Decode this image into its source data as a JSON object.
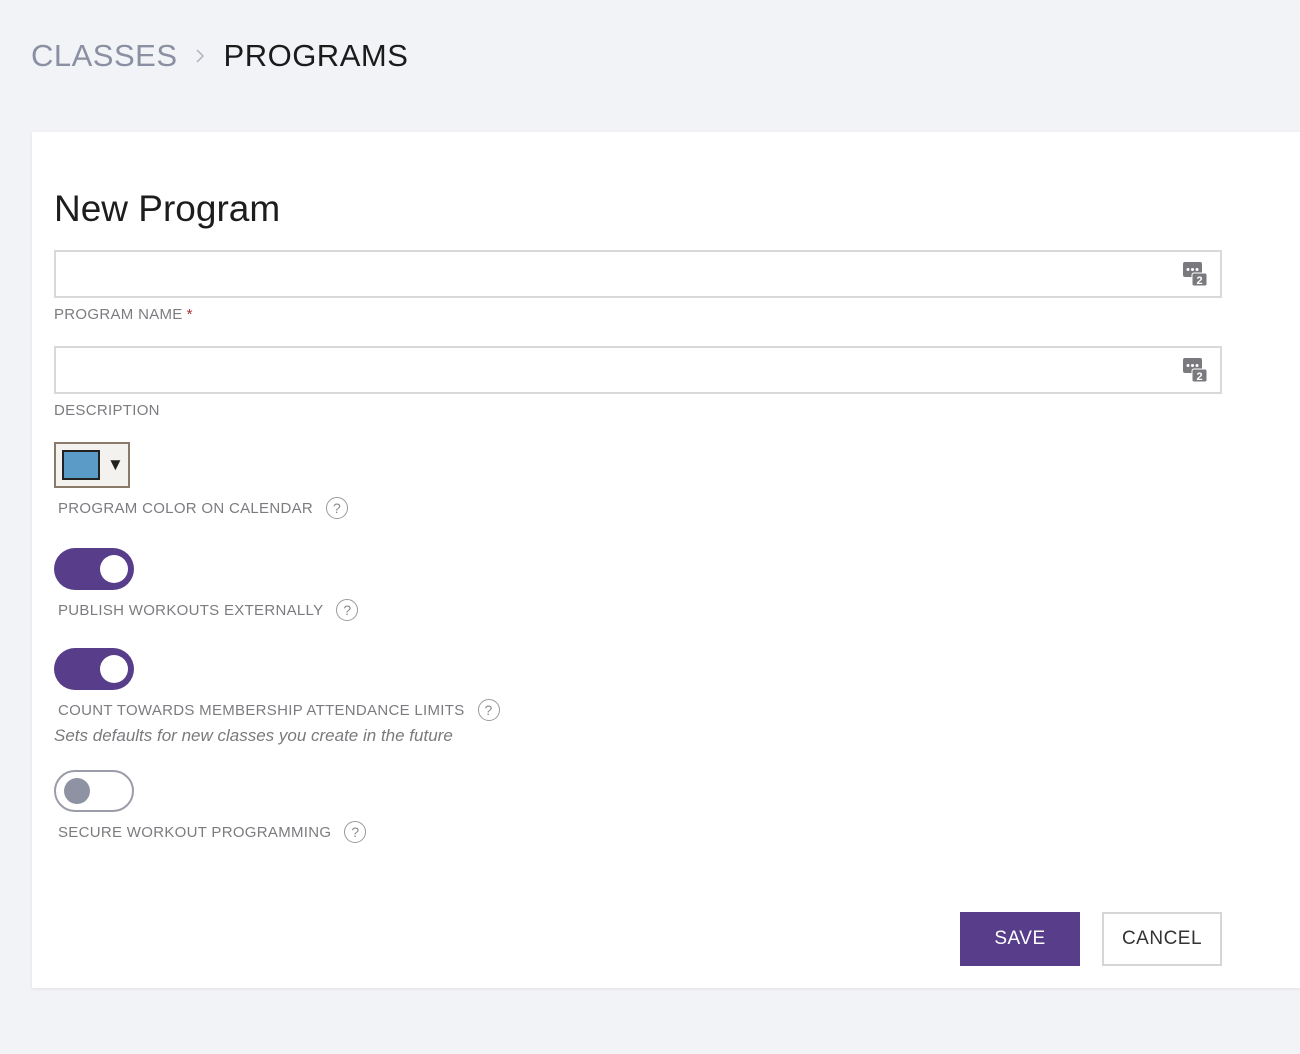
{
  "breadcrumb": {
    "parent": "CLASSES",
    "current": "PROGRAMS"
  },
  "form": {
    "title": "New Program",
    "program_name": {
      "value": "",
      "placeholder": "",
      "label": "PROGRAM NAME",
      "required_marker": "*",
      "icon": "translate-icon"
    },
    "description": {
      "value": "",
      "placeholder": "",
      "label": "DESCRIPTION",
      "icon": "translate-icon"
    },
    "program_color": {
      "label": "PROGRAM COLOR ON CALENDAR",
      "value": "#5b9bc7",
      "caret": "▼",
      "help": "?"
    },
    "publish_workouts": {
      "label": "PUBLISH WORKOUTS EXTERNALLY",
      "enabled": true,
      "help": "?"
    },
    "count_attendance": {
      "label": "COUNT TOWARDS MEMBERSHIP ATTENDANCE LIMITS",
      "enabled": true,
      "help": "?",
      "hint": "Sets defaults for new classes you create in the future"
    },
    "secure_programming": {
      "label": "SECURE WORKOUT PROGRAMMING",
      "enabled": false,
      "help": "?"
    },
    "buttons": {
      "save": "SAVE",
      "cancel": "CANCEL"
    }
  },
  "colors": {
    "accent": "#583d8a",
    "background": "#f2f3f7",
    "muted_text": "#7c7c80"
  }
}
